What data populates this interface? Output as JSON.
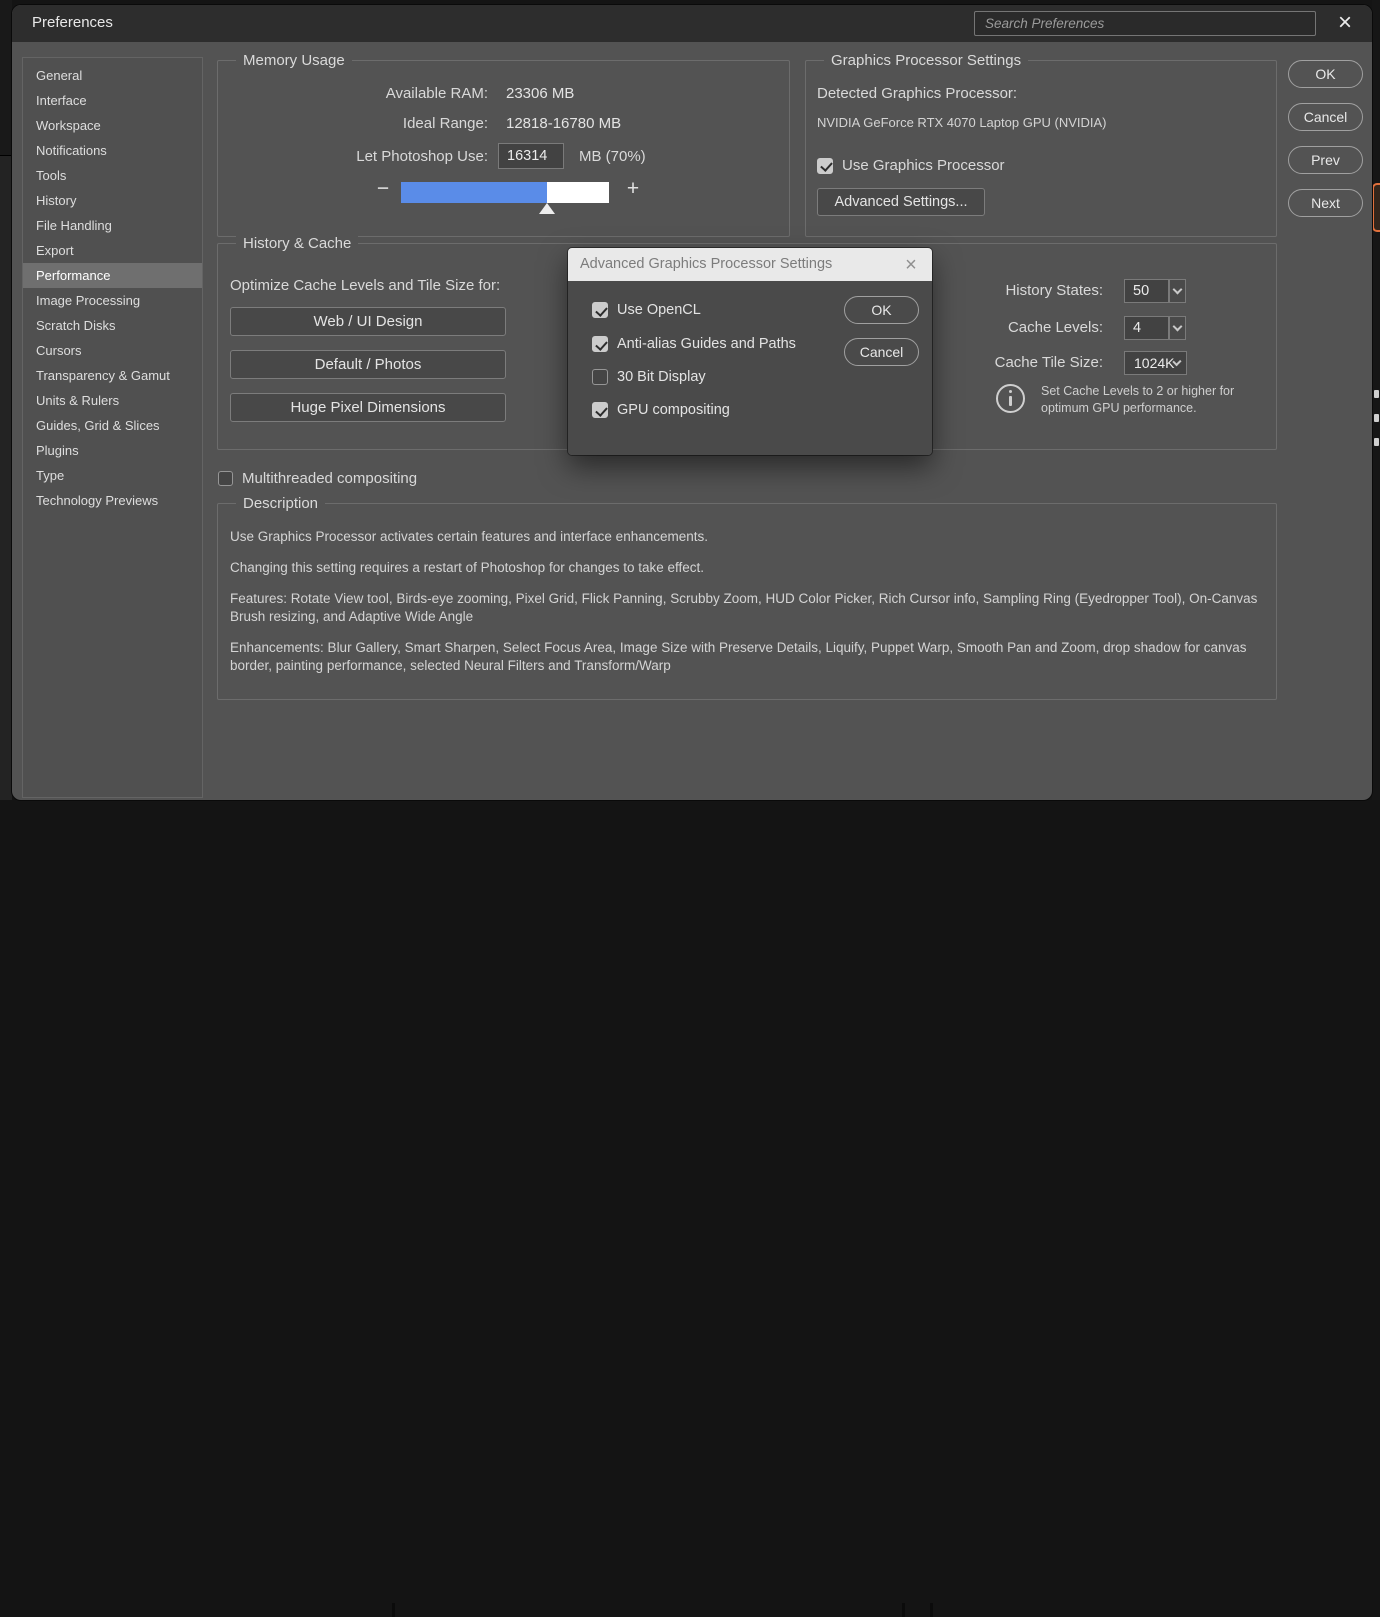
{
  "colors": {
    "accent_blue": "#5a8ce8",
    "highlight_orange": "#e0703c"
  },
  "titlebar": {
    "title": "Preferences",
    "search_placeholder": "Search Preferences",
    "close_icon": "×"
  },
  "sidebar": {
    "items": [
      {
        "label": "General",
        "selected": false
      },
      {
        "label": "Interface",
        "selected": false
      },
      {
        "label": "Workspace",
        "selected": false
      },
      {
        "label": "Notifications",
        "selected": false
      },
      {
        "label": "Tools",
        "selected": false
      },
      {
        "label": "History",
        "selected": false
      },
      {
        "label": "File Handling",
        "selected": false
      },
      {
        "label": "Export",
        "selected": false
      },
      {
        "label": "Performance",
        "selected": true
      },
      {
        "label": "Image Processing",
        "selected": false
      },
      {
        "label": "Scratch Disks",
        "selected": false
      },
      {
        "label": "Cursors",
        "selected": false
      },
      {
        "label": "Transparency & Gamut",
        "selected": false
      },
      {
        "label": "Units & Rulers",
        "selected": false
      },
      {
        "label": "Guides, Grid & Slices",
        "selected": false
      },
      {
        "label": "Plugins",
        "selected": false
      },
      {
        "label": "Type",
        "selected": false
      },
      {
        "label": "Technology Previews",
        "selected": false
      }
    ]
  },
  "actions": {
    "ok": "OK",
    "cancel": "Cancel",
    "prev": "Prev",
    "next": "Next"
  },
  "memory": {
    "legend": "Memory Usage",
    "available_ram_label": "Available RAM:",
    "available_ram_value": "23306 MB",
    "ideal_range_label": "Ideal Range:",
    "ideal_range_value": "12818-16780 MB",
    "let_use_label": "Let Photoshop Use:",
    "let_use_value": "16314",
    "let_use_unit": "MB (70%)",
    "slider_percent": 70,
    "decrease_icon": "−",
    "increase_icon": "+"
  },
  "gpu": {
    "legend": "Graphics Processor Settings",
    "detected_label": "Detected Graphics Processor:",
    "detected_value": "NVIDIA GeForce RTX 4070 Laptop GPU (NVIDIA)",
    "use_gpu": {
      "label": "Use Graphics Processor",
      "checked": true
    },
    "advanced_button": "Advanced Settings..."
  },
  "history_cache": {
    "legend": "History & Cache",
    "optimize_label": "Optimize Cache Levels and Tile Size for:",
    "presets": [
      {
        "label": "Web / UI Design"
      },
      {
        "label": "Default / Photos"
      },
      {
        "label": "Huge Pixel Dimensions"
      }
    ],
    "history_states": {
      "label": "History States:",
      "value": "50"
    },
    "cache_levels": {
      "label": "Cache Levels:",
      "value": "4"
    },
    "cache_tile_size": {
      "label": "Cache Tile Size:",
      "value": "1024K"
    },
    "info_text": "Set Cache Levels to 2 or higher for optimum GPU performance."
  },
  "multithreaded": {
    "label": "Multithreaded compositing",
    "checked": false
  },
  "description": {
    "legend": "Description",
    "paragraphs": [
      "Use Graphics Processor activates certain features and interface enhancements.",
      "Changing this setting requires a restart of Photoshop for changes to take effect.",
      "Features: Rotate View tool, Birds-eye zooming, Pixel Grid, Flick Panning, Scrubby Zoom, HUD Color Picker, Rich Cursor info, Sampling Ring (Eyedropper Tool), On-Canvas Brush resizing, and Adaptive Wide Angle",
      "Enhancements: Blur Gallery, Smart Sharpen, Select Focus Area, Image Size with Preserve Details, Liquify, Puppet Warp, Smooth Pan and Zoom, drop shadow for canvas border, painting performance, selected Neural Filters and Transform/Warp"
    ]
  },
  "modal": {
    "title": "Advanced Graphics Processor Settings",
    "close_icon": "×",
    "checkboxes": [
      {
        "label": "Use OpenCL",
        "checked": true
      },
      {
        "label": "Anti-alias Guides and Paths",
        "checked": true
      },
      {
        "label": "30 Bit Display",
        "checked": false
      },
      {
        "label": "GPU compositing",
        "checked": true
      }
    ],
    "ok": "OK",
    "cancel": "Cancel"
  }
}
